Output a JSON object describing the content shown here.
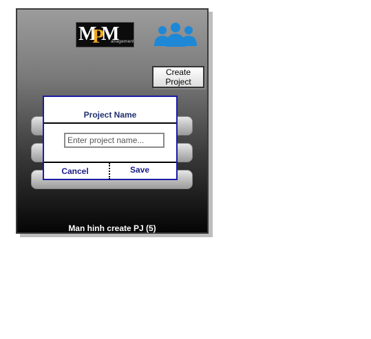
{
  "logo": {
    "letters": [
      "M",
      "P",
      "M"
    ],
    "subtext": "anagement",
    "accent_color": "#f2a81c"
  },
  "header": {
    "users_icon": "users-group-icon",
    "icon_color": "#1e88d6",
    "create_button_label": "Create\nProject"
  },
  "dialog": {
    "title": "Project Name",
    "input": {
      "value": "",
      "placeholder": "Enter project name..."
    },
    "cancel_label": "Cancel",
    "save_label": "Save",
    "border_color": "#1a1aa6"
  },
  "footer": {
    "caption": "Man hinh create PJ (5)"
  }
}
